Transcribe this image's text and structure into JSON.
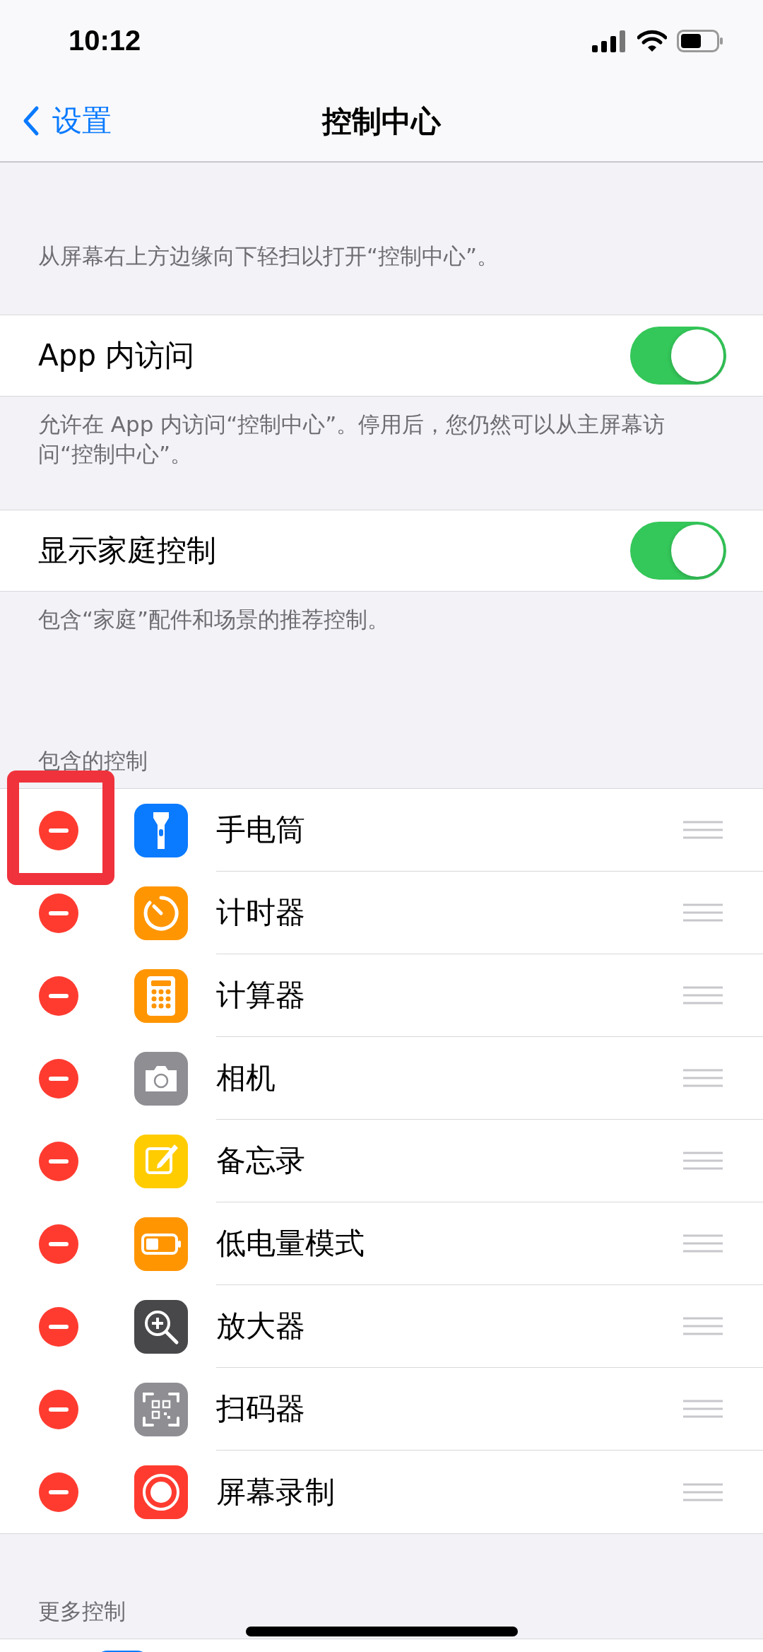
{
  "status_bar": {
    "time": "10:12"
  },
  "nav": {
    "back": "设置",
    "title": "控制中心"
  },
  "intro": "从屏幕右上方边缘向下轻扫以打开“控制中心”。",
  "settings": [
    {
      "label": "App 内访问",
      "on": true,
      "footer": "允许在 App 内访问“控制中心”。停用后，您仍然可以从主屏幕访问“控制中心”。"
    },
    {
      "label": "显示家庭控制",
      "on": true,
      "footer": "包含“家庭”配件和场景的推荐控制。"
    }
  ],
  "included": {
    "header": "包含的控制",
    "items": [
      {
        "label": "手电筒",
        "kind": "flashlight",
        "color": "#0a7aff"
      },
      {
        "label": "计时器",
        "kind": "timer",
        "color": "#ff9500"
      },
      {
        "label": "计算器",
        "kind": "calculator",
        "color": "#ff9500"
      },
      {
        "label": "相机",
        "kind": "camera",
        "color": "#8e8e93"
      },
      {
        "label": "备忘录",
        "kind": "notes",
        "color": "#ffcc00"
      },
      {
        "label": "低电量模式",
        "kind": "battery",
        "color": "#ff9500"
      },
      {
        "label": "放大器",
        "kind": "magnifier",
        "color": "#48484a"
      },
      {
        "label": "扫码器",
        "kind": "qr",
        "color": "#8e8e93"
      },
      {
        "label": "屏幕录制",
        "kind": "record",
        "color": "#ff3b30"
      }
    ]
  },
  "more": {
    "header": "更多控制"
  }
}
